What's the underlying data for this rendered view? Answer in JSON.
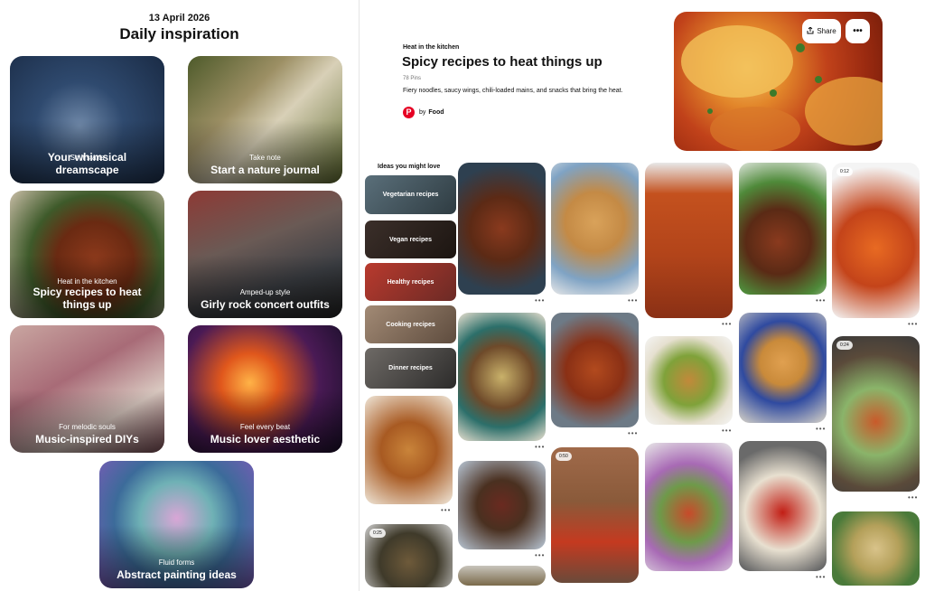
{
  "left": {
    "date": "13 April 2026",
    "heading": "Daily inspiration",
    "cards": [
      {
        "subtitle": "So it starts",
        "title": "Your whimsical dreamscape"
      },
      {
        "subtitle": "Take note",
        "title": "Start a nature journal"
      },
      {
        "subtitle": "Heat in the kitchen",
        "title": "Spicy recipes to heat things up"
      },
      {
        "subtitle": "Amped-up style",
        "title": "Girly rock concert outfits"
      },
      {
        "subtitle": "For melodic souls",
        "title": "Music-inspired DIYs"
      },
      {
        "subtitle": "Feel every beat",
        "title": "Music lover aesthetic"
      },
      {
        "subtitle": "Fluid forms",
        "title": "Abstract painting ideas"
      }
    ]
  },
  "board": {
    "kicker": "Heat in the kitchen",
    "title": "Spicy recipes to heat things up",
    "pin_count": "78 Pins",
    "description": "Fiery noodles, saucy wings, chili-loaded mains, and snacks that bring the heat.",
    "by": "by",
    "author": "Food",
    "logo_letter": "P",
    "share_label": "Share",
    "more_label": "•••"
  },
  "ideas": {
    "heading": "Ideas you might love",
    "items": [
      {
        "label": "Vegetarian recipes"
      },
      {
        "label": "Vegan recipes"
      },
      {
        "label": "Healthy recipes"
      },
      {
        "label": "Cooking recipes"
      },
      {
        "label": "Dinner recipes"
      }
    ]
  },
  "pins": {
    "more": "•••",
    "badges": [
      "0:12",
      "0:24",
      "0:50",
      "0:25"
    ]
  },
  "colors": {
    "brand": "#e60023"
  }
}
